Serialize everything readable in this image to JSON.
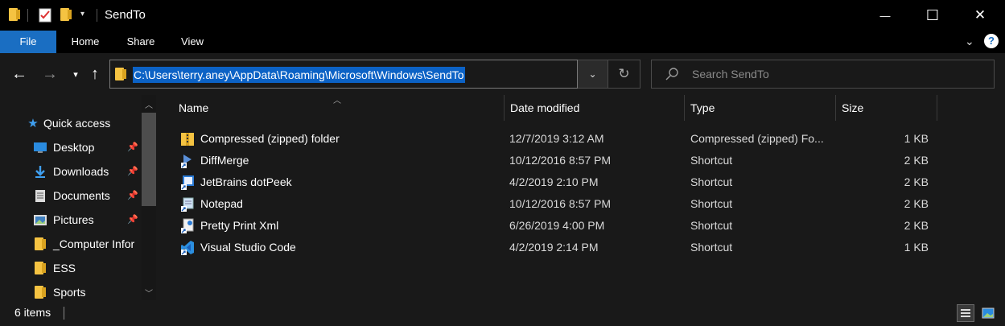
{
  "window": {
    "title": "SendTo",
    "minimize_glyph": "—",
    "maximize_glyph": "☐",
    "close_glyph": "✕"
  },
  "ribbon": {
    "tabs": [
      {
        "label": "File",
        "active": true
      },
      {
        "label": "Home",
        "active": false
      },
      {
        "label": "Share",
        "active": false
      },
      {
        "label": "View",
        "active": false
      }
    ]
  },
  "address": {
    "path": "C:\\Users\\terry.aney\\AppData\\Roaming\\Microsoft\\Windows\\SendTo"
  },
  "search": {
    "placeholder": "Search SendTo"
  },
  "nav": {
    "quick_access_label": "Quick access",
    "items": [
      {
        "label": "Desktop",
        "icon": "desktop-icon",
        "pinned": true
      },
      {
        "label": "Downloads",
        "icon": "download-icon",
        "pinned": true
      },
      {
        "label": "Documents",
        "icon": "documents-icon",
        "pinned": true
      },
      {
        "label": "Pictures",
        "icon": "pictures-icon",
        "pinned": true
      },
      {
        "label": "_Computer Infor",
        "icon": "folder-icon",
        "pinned": false
      },
      {
        "label": "ESS",
        "icon": "folder-icon",
        "pinned": false
      },
      {
        "label": "Sports",
        "icon": "folder-icon",
        "pinned": false
      }
    ]
  },
  "columns": {
    "name": "Name",
    "date": "Date modified",
    "type": "Type",
    "size": "Size"
  },
  "files": [
    {
      "name": "Compressed (zipped) folder",
      "date": "12/7/2019 3:12 AM",
      "type": "Compressed (zipped) Fo...",
      "size": "1 KB",
      "icon": "zip-folder-icon"
    },
    {
      "name": "DiffMerge",
      "date": "10/12/2016 8:57 PM",
      "type": "Shortcut",
      "size": "2 KB",
      "icon": "diffmerge-shortcut-icon"
    },
    {
      "name": "JetBrains dotPeek",
      "date": "4/2/2019 2:10 PM",
      "type": "Shortcut",
      "size": "2 KB",
      "icon": "dotpeek-shortcut-icon"
    },
    {
      "name": "Notepad",
      "date": "10/12/2016 8:57 PM",
      "type": "Shortcut",
      "size": "2 KB",
      "icon": "notepad-shortcut-icon"
    },
    {
      "name": "Pretty Print Xml",
      "date": "6/26/2019 4:00 PM",
      "type": "Shortcut",
      "size": "2 KB",
      "icon": "xml-shortcut-icon"
    },
    {
      "name": "Visual Studio Code",
      "date": "4/2/2019 2:14 PM",
      "type": "Shortcut",
      "size": "1 KB",
      "icon": "vscode-shortcut-icon"
    }
  ],
  "status": {
    "count_text": "6 items"
  },
  "colors": {
    "accent": "#1a6ec2",
    "background": "#191919",
    "selection": "#0c62c5"
  }
}
